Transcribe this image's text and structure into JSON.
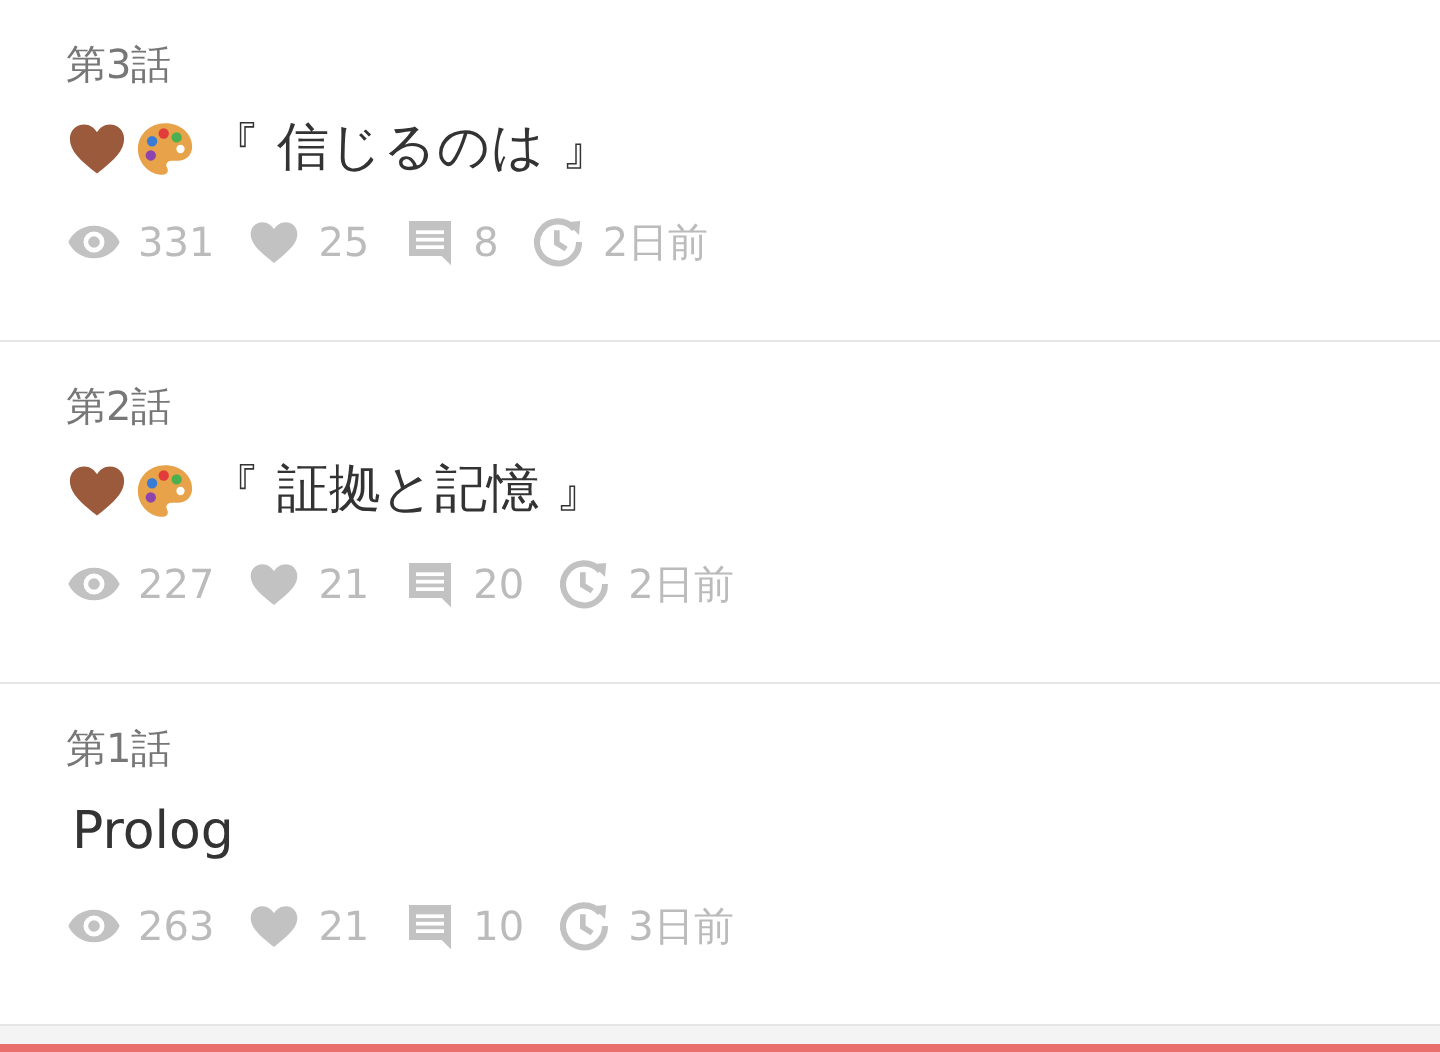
{
  "episodes": [
    {
      "label": "第3話",
      "title": "『 信じるのは 』",
      "decorated": true,
      "views": "331",
      "likes": "25",
      "comments": "8",
      "updated": "2日前"
    },
    {
      "label": "第2話",
      "title": "『 証拠と記憶 』",
      "decorated": true,
      "views": "227",
      "likes": "21",
      "comments": "20",
      "updated": "2日前"
    },
    {
      "label": "第1話",
      "title": "Prolog",
      "decorated": false,
      "views": "263",
      "likes": "21",
      "comments": "10",
      "updated": "3日前"
    }
  ]
}
